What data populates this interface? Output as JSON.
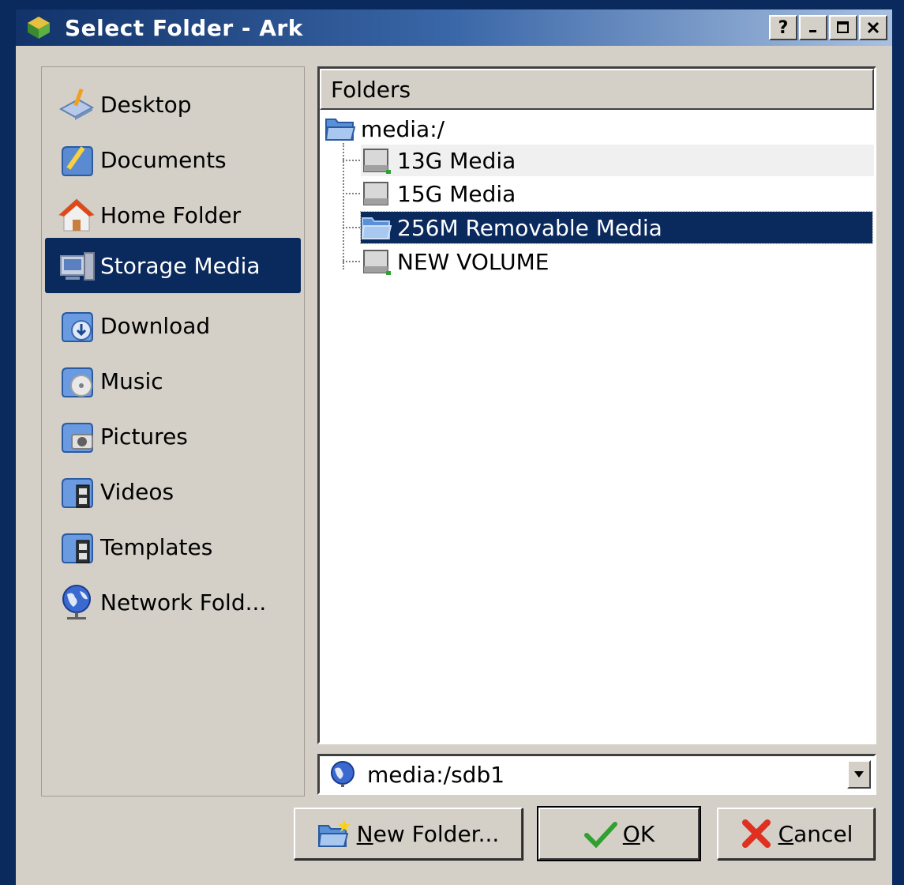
{
  "window": {
    "title": "Select Folder - Ark",
    "buttons": [
      "?",
      "_",
      "□",
      "×"
    ]
  },
  "places": {
    "items": [
      {
        "label": "Desktop",
        "icon": "desktop-icon"
      },
      {
        "label": "Documents",
        "icon": "documents-icon"
      },
      {
        "label": "Home Folder",
        "icon": "home-icon"
      },
      {
        "label": "Storage Media",
        "icon": "storage-media-icon",
        "selected": true
      },
      {
        "label": "Download",
        "icon": "download-icon"
      },
      {
        "label": "Music",
        "icon": "music-icon"
      },
      {
        "label": "Pictures",
        "icon": "pictures-icon"
      },
      {
        "label": "Videos",
        "icon": "videos-icon"
      },
      {
        "label": "Templates",
        "icon": "templates-icon"
      },
      {
        "label": "Network Fold...",
        "icon": "network-icon"
      }
    ]
  },
  "tree": {
    "header": "Folders",
    "root": "media:/",
    "children": [
      {
        "label": "13G Media",
        "icon": "harddisk-icon"
      },
      {
        "label": "15G Media",
        "icon": "harddisk-icon"
      },
      {
        "label": "256M Removable Media",
        "icon": "folder-icon",
        "selected": true
      },
      {
        "label": "NEW VOLUME",
        "icon": "harddisk-icon"
      }
    ]
  },
  "location": {
    "value": "media:/sdb1"
  },
  "buttons": {
    "new_folder": "New Folder...",
    "ok": "OK",
    "cancel": "Cancel"
  },
  "colors": {
    "selection": "#0a2a5e",
    "window_bg": "#d4d0c8"
  }
}
